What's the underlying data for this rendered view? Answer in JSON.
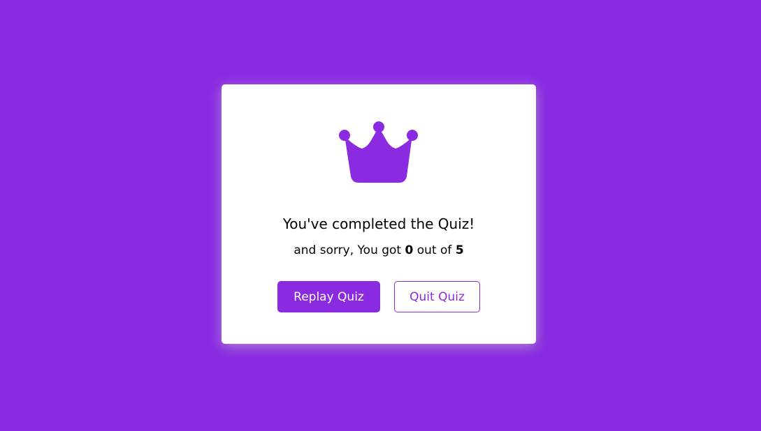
{
  "colors": {
    "background": "#8a2be2",
    "card": "#ffffff",
    "accent": "#8a2be2",
    "text": "#000000"
  },
  "result": {
    "icon": "crown-icon",
    "complete_text": "You've completed the Quiz!",
    "score_prefix": "and sorry, You got",
    "score_value": "0",
    "score_middle": "out of",
    "score_total": "5"
  },
  "buttons": {
    "replay_label": "Replay Quiz",
    "quit_label": "Quit Quiz"
  }
}
